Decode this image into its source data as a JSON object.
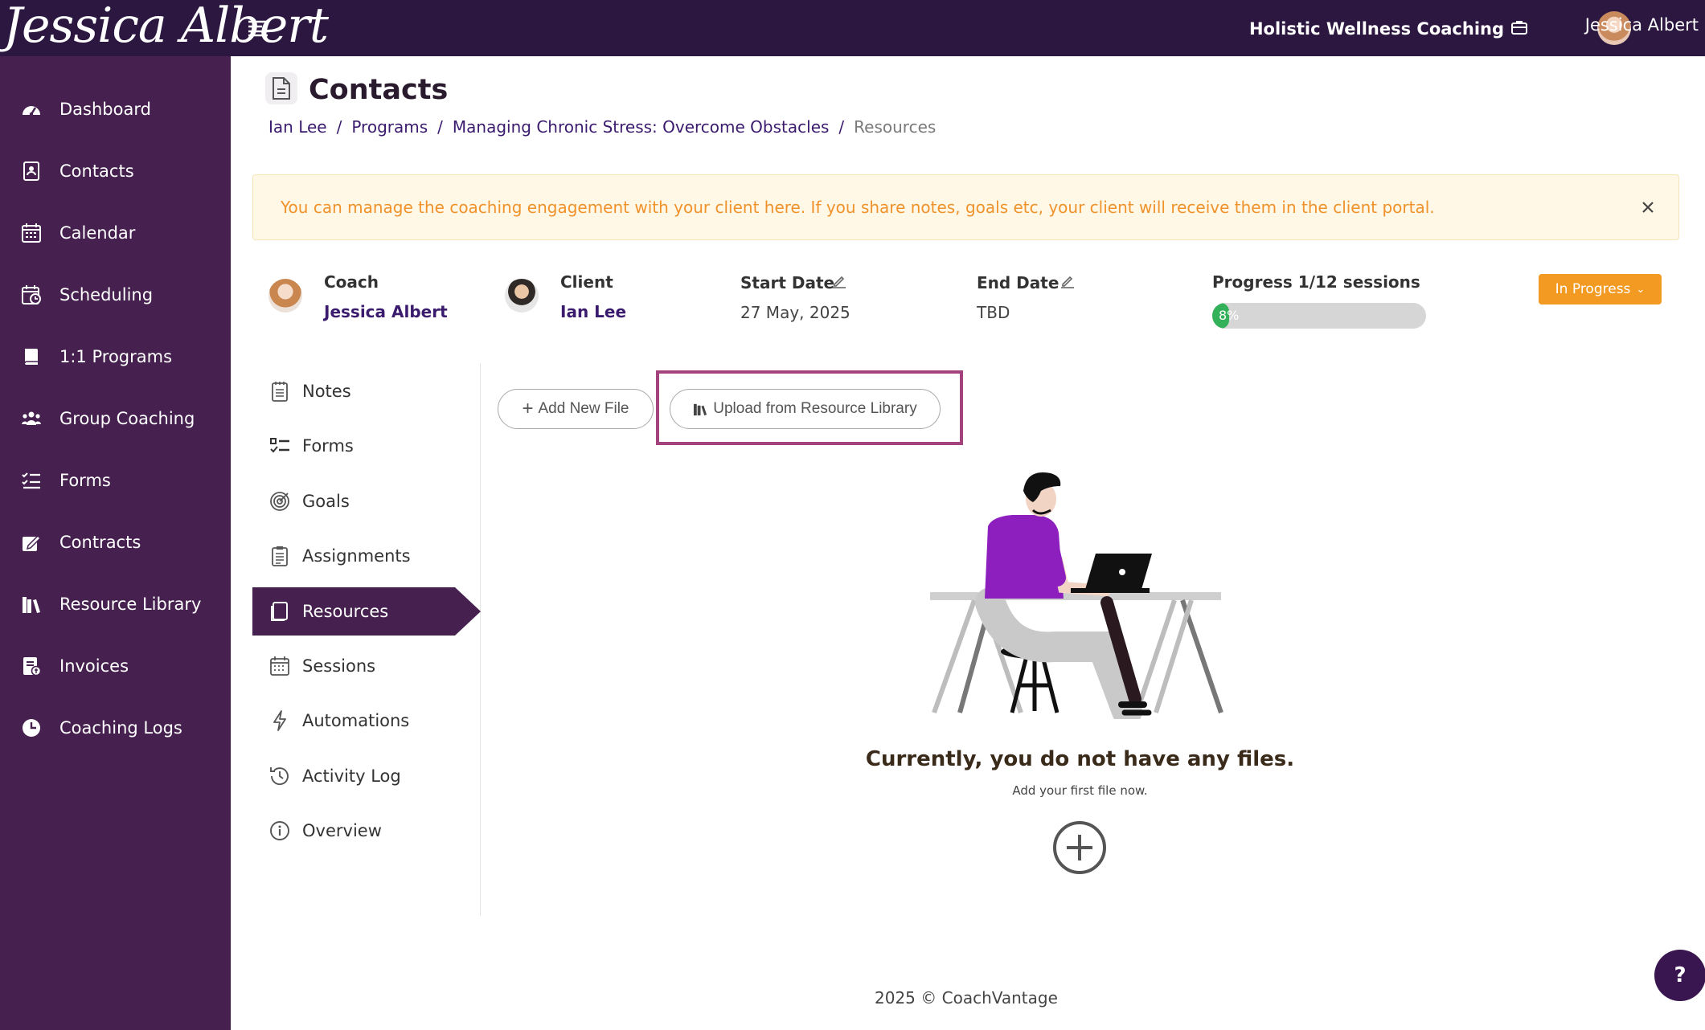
{
  "brand": {
    "logo_text": "Jessica Albert"
  },
  "header": {
    "org_name": "Holistic Wellness Coaching",
    "user_name": "Jessica Albert"
  },
  "sidebar": {
    "items": [
      {
        "label": "Dashboard",
        "icon": "dashboard-icon"
      },
      {
        "label": "Contacts",
        "icon": "contacts-icon"
      },
      {
        "label": "Calendar",
        "icon": "calendar-icon"
      },
      {
        "label": "Scheduling",
        "icon": "scheduling-icon"
      },
      {
        "label": "1:1 Programs",
        "icon": "book-icon"
      },
      {
        "label": "Group Coaching",
        "icon": "group-icon"
      },
      {
        "label": "Forms",
        "icon": "checklist-icon"
      },
      {
        "label": "Contracts",
        "icon": "contract-icon"
      },
      {
        "label": "Resource Library",
        "icon": "library-icon"
      },
      {
        "label": "Invoices",
        "icon": "invoice-icon"
      },
      {
        "label": "Coaching Logs",
        "icon": "clock-icon"
      }
    ]
  },
  "page": {
    "title": "Contacts",
    "breadcrumb": [
      "Ian Lee",
      "Programs",
      "Managing Chronic Stress: Overcome Obstacles",
      "Resources"
    ],
    "breadcrumb_separator": "/"
  },
  "alert": {
    "text": "You can manage the coaching engagement with your client here. If you share notes, goals etc, your client will receive them in the client portal."
  },
  "engagement": {
    "coach_label": "Coach",
    "coach_name": "Jessica Albert",
    "client_label": "Client",
    "client_name": "Ian Lee",
    "start_label": "Start Date",
    "start_value": "27 May, 2025",
    "end_label": "End Date",
    "end_value": "TBD",
    "progress_label": "Progress 1/12 sessions",
    "progress_text": "8%",
    "progress_percent": 8,
    "status": "In Progress"
  },
  "subnav": {
    "items": [
      {
        "label": "Notes",
        "icon": "notes-icon"
      },
      {
        "label": "Forms",
        "icon": "forms-icon"
      },
      {
        "label": "Goals",
        "icon": "target-icon"
      },
      {
        "label": "Assignments",
        "icon": "clipboard-icon"
      },
      {
        "label": "Resources",
        "icon": "resources-icon"
      },
      {
        "label": "Sessions",
        "icon": "calendar-grid-icon"
      },
      {
        "label": "Automations",
        "icon": "lightning-icon"
      },
      {
        "label": "Activity Log",
        "icon": "history-icon"
      },
      {
        "label": "Overview",
        "icon": "info-icon"
      }
    ],
    "active_index": 4
  },
  "content": {
    "add_file_label": "Add New File",
    "upload_label": "Upload from Resource Library",
    "empty_title": "Currently, you do not have any files.",
    "empty_subtitle": "Add your first file now."
  },
  "footer": {
    "text": "2025 © CoachVantage"
  },
  "help": {
    "label": "?"
  },
  "colors": {
    "sidebar": "#46204f",
    "topbar": "#2c1740",
    "accent": "#f39a22",
    "highlight": "#a3427c",
    "progress": "#33b05a"
  }
}
